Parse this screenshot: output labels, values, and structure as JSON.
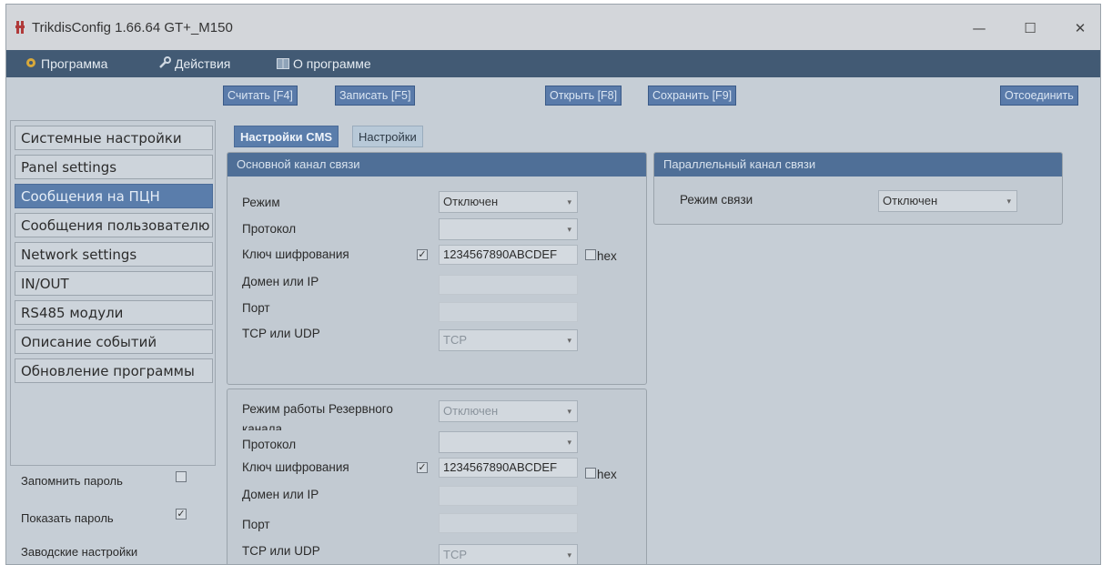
{
  "window": {
    "title": "TrikdisConfig 1.66.64   GT+_M150",
    "minimize": "—",
    "maximize": "☐",
    "close": "✕"
  },
  "menu": {
    "program": "Программа",
    "actions": "Действия",
    "about": "О программе"
  },
  "toolbar": {
    "read": "Считать [F4]",
    "write": "Записать [F5]",
    "open": "Открыть [F8]",
    "save": "Сохранить [F9]",
    "disconnect": "Отсоединить"
  },
  "sidebar": {
    "items": [
      {
        "label": "Системные настройки"
      },
      {
        "label": "Panel settings"
      },
      {
        "label": "Сообщения на ПЦН"
      },
      {
        "label": "Сообщения пользователю"
      },
      {
        "label": "Network settings"
      },
      {
        "label": "IN/OUT"
      },
      {
        "label": "RS485 модули"
      },
      {
        "label": "Описание событий"
      },
      {
        "label": "Обновление программы"
      }
    ],
    "active_index": 2
  },
  "options": {
    "remember_password": "Запомнить пароль",
    "remember_checked": false,
    "show_password": "Показать пароль",
    "show_checked": true,
    "factory_settings": "Заводские настройки"
  },
  "tabs": [
    {
      "label": "Настройки CMS",
      "active": true
    },
    {
      "label": "Настройки",
      "active": false
    }
  ],
  "primary": {
    "title": "Основной канал связи",
    "mode_label": "Режим",
    "mode_value": "Отключен",
    "protocol_label": "Протокол",
    "protocol_value": "",
    "key_label": "Ключ шифрования",
    "key_checked": true,
    "key_value": "1234567890ABCDEF",
    "hex_label": "hex",
    "domain_label": "Домен или IP",
    "domain_value": "",
    "port_label": "Порт",
    "port_value": "",
    "tcp_label": "TCP или UDP",
    "tcp_value": "TCP"
  },
  "backup": {
    "mode_label": "Режим работы Резервного канала",
    "mode_value": "Отключен",
    "protocol_label": "Протокол",
    "protocol_value": "",
    "key_label": "Ключ шифрования",
    "key_checked": true,
    "key_value": "1234567890ABCDEF",
    "hex_label": "hex",
    "domain_label": "Домен или IP",
    "domain_value": "",
    "port_label": "Порт",
    "port_value": "",
    "tcp_label": "TCP или UDP",
    "tcp_value": "TCP"
  },
  "parallel": {
    "title": "Параллельный канал связи",
    "mode_label": "Режим связи",
    "mode_value": "Отключен"
  },
  "colors": {
    "menubar": "#425a74",
    "accent": "#5a7dab",
    "panel_head": "#4f6f97"
  }
}
